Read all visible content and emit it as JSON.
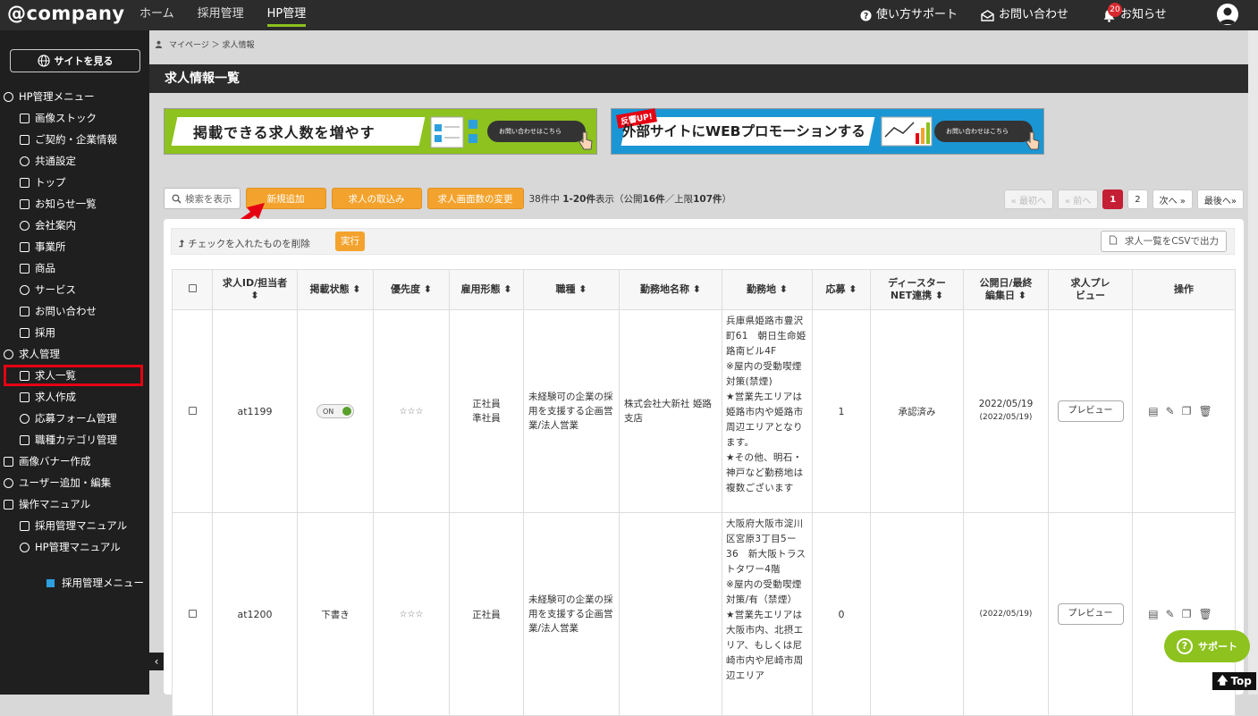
{
  "header": {
    "logo": "@company",
    "nav": [
      "ホーム",
      "採用管理",
      "HP管理"
    ],
    "active_nav": "HP管理",
    "support_label": "使い方サポート",
    "contact_label": "お問い合わせ",
    "notice_label": "お知らせ",
    "notice_count": "20"
  },
  "sidebar": {
    "site_button": "サイトを見る",
    "items": [
      {
        "label": "HP管理メニュー",
        "type": "sec"
      },
      {
        "label": "画像ストック",
        "type": "sub"
      },
      {
        "label": "ご契約・企業情報",
        "type": "sub"
      },
      {
        "label": "共通設定",
        "type": "sub"
      },
      {
        "label": "トップ",
        "type": "sub"
      },
      {
        "label": "お知らせ一覧",
        "type": "sub"
      },
      {
        "label": "会社案内",
        "type": "sub"
      },
      {
        "label": "事業所",
        "type": "sub"
      },
      {
        "label": "商品",
        "type": "sub"
      },
      {
        "label": "サービス",
        "type": "sub"
      },
      {
        "label": "お問い合わせ",
        "type": "sub"
      },
      {
        "label": "採用",
        "type": "sub"
      },
      {
        "label": "求人管理",
        "type": "sec"
      },
      {
        "label": "求人一覧",
        "type": "sub",
        "highlight": true
      },
      {
        "label": "求人作成",
        "type": "sub"
      },
      {
        "label": "応募フォーム管理",
        "type": "sub"
      },
      {
        "label": "職種カテゴリ管理",
        "type": "sub"
      },
      {
        "label": "画像バナー作成",
        "type": "sec"
      },
      {
        "label": "ユーザー追加・編集",
        "type": "sec"
      },
      {
        "label": "操作マニュアル",
        "type": "sec"
      },
      {
        "label": "採用管理マニュアル",
        "type": "sub"
      },
      {
        "label": "HP管理マニュアル",
        "type": "sub"
      }
    ],
    "footer_link": "採用管理メニュー"
  },
  "breadcrumb": "マイページ ＞ 求人情報",
  "page_title": "求人情報一覧",
  "banners": {
    "b1_text": "掲載できる求人数を増やす",
    "b1_button": "お問い合わせはこちら",
    "b2_tag": "反響UP!",
    "b2_text": "外部サイトにWEBプロモーションする",
    "b2_button": "お問い合わせはこちら"
  },
  "toolbar": {
    "search": "検索を表示",
    "new": "新規追加",
    "import": "求人の取込み",
    "change_count": "求人画面数の変更",
    "count_prefix": "38件中 ",
    "count_range": "1-20件",
    "count_mid": "表示（公開",
    "count_public": "16件",
    "count_sep": "／上限",
    "count_limit": "107件",
    "count_suffix": "）"
  },
  "pager": {
    "first": "« 最初へ",
    "prev": "« 前へ",
    "pages": [
      "1",
      "2"
    ],
    "next": "次へ »",
    "last": "最後へ»"
  },
  "actions": {
    "delete_label": "チェックを入れたものを削除",
    "exec": "実行",
    "csv": "求人一覧をCSVで出力"
  },
  "table": {
    "headers": [
      "求人ID/担当者 ⬍",
      "掲載状態 ⬍",
      "優先度 ⬍",
      "雇用形態 ⬍",
      "職種 ⬍",
      "勤務地名称 ⬍",
      "勤務地 ⬍",
      "応募 ⬍",
      "ディースターNET連携 ⬍",
      "公開日/最終編集日 ⬍",
      "求人プレビュー",
      "操作"
    ],
    "rows": [
      {
        "id": "at1199",
        "status": "ON",
        "priority": "☆☆☆",
        "employment": "正社員\n準社員",
        "job": "未経験可の企業の採用を支援する企画営業/法人営業",
        "place_name": "株式会社大新社 姫路支店",
        "location": "兵庫県姫路市豊沢町61　朝日生命姫路南ビル4F\n※屋内の受動喫煙対策(禁煙)\n★営業先エリアは姫路市内や姫路市周辺エリアとなります。\n★その他、明石・神戸など勤務地は複数ございます",
        "applications": "1",
        "dstar": "承認済み",
        "published": "2022/05/19",
        "edited": "(2022/05/19)",
        "preview": "プレビュー"
      },
      {
        "id": "at1200",
        "status": "下書き",
        "priority": "☆☆☆",
        "employment": "正社員",
        "job": "未経験可の企業の採用を支援する企画営業/法人営業",
        "place_name": "",
        "location": "大阪府大阪市淀川区宮原3丁目5ー36　新大阪トラストタワー4階\n※屋内の受動喫煙対策/有（禁煙）\n★営業先エリアは大阪市内、北摂エリア、もしくは尼崎市内や尼崎市周辺エリア",
        "applications": "0",
        "dstar": "",
        "published": "",
        "edited": "(2022/05/19)",
        "preview": "プレビュー"
      }
    ]
  },
  "floating": {
    "support": "サポート",
    "top": "Top"
  },
  "colors": {
    "accent_green": "#8dc21f",
    "orange": "#f3a32d",
    "highlight_red": "#e50012",
    "topbar": "#2c2c2c"
  }
}
